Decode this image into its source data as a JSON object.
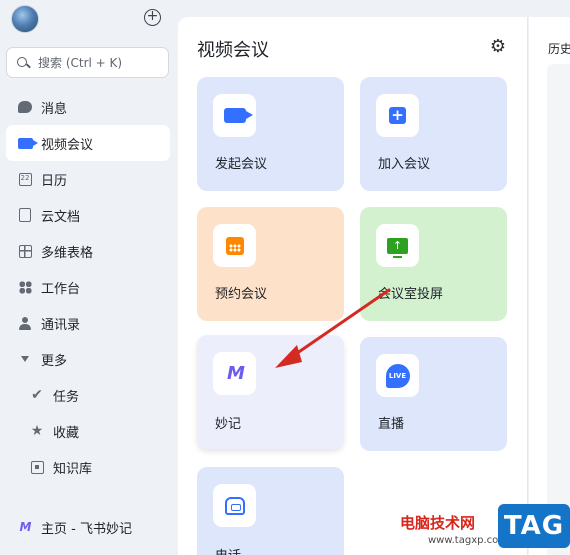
{
  "sidebar": {
    "add_icon": "plus-circle-icon",
    "search_placeholder": "搜索 (Ctrl + K)",
    "items": [
      {
        "label": "消息",
        "icon": "message-icon",
        "active": false
      },
      {
        "label": "视频会议",
        "icon": "video-icon",
        "active": true
      },
      {
        "label": "日历",
        "icon": "calendar-icon",
        "active": false
      },
      {
        "label": "云文档",
        "icon": "doc-icon",
        "active": false
      },
      {
        "label": "多维表格",
        "icon": "table-icon",
        "active": false
      },
      {
        "label": "工作台",
        "icon": "apps-icon",
        "active": false
      },
      {
        "label": "通讯录",
        "icon": "contacts-icon",
        "active": false
      },
      {
        "label": "更多",
        "icon": "caret-down-icon",
        "active": false
      },
      {
        "label": "任务",
        "icon": "check-icon",
        "active": false
      },
      {
        "label": "收藏",
        "icon": "star-icon",
        "active": false
      },
      {
        "label": "知识库",
        "icon": "library-icon",
        "active": false
      }
    ],
    "bottom_label": "主页 - 飞书妙记",
    "calendar_glyph": "22"
  },
  "main": {
    "title": "视频会议",
    "settings_icon": "gear-icon",
    "cards": [
      {
        "label": "发起会议",
        "icon": "camera-icon",
        "color": "#dde6fb"
      },
      {
        "label": "加入会议",
        "icon": "add-square-icon",
        "color": "#dde6fb"
      },
      {
        "label": "预约会议",
        "icon": "schedule-icon",
        "color": "#fde1c9"
      },
      {
        "label": "会议室投屏",
        "icon": "screen-share-icon",
        "color": "#d3f1cf"
      },
      {
        "label": "妙记",
        "icon": "miaoji-icon",
        "color": "#eceefc"
      },
      {
        "label": "直播",
        "icon": "live-icon",
        "color": "#dde6fb"
      },
      {
        "label": "电话",
        "icon": "phone-icon",
        "color": "#dde6fb"
      }
    ],
    "live_badge": "LIVE"
  },
  "history": {
    "title": "历史"
  },
  "watermark": {
    "text": "电脑技术网",
    "url": "www.tagxp.com",
    "tag": "TAG"
  },
  "colors": {
    "accent": "#3370ff",
    "arrow": "#d42a22"
  }
}
